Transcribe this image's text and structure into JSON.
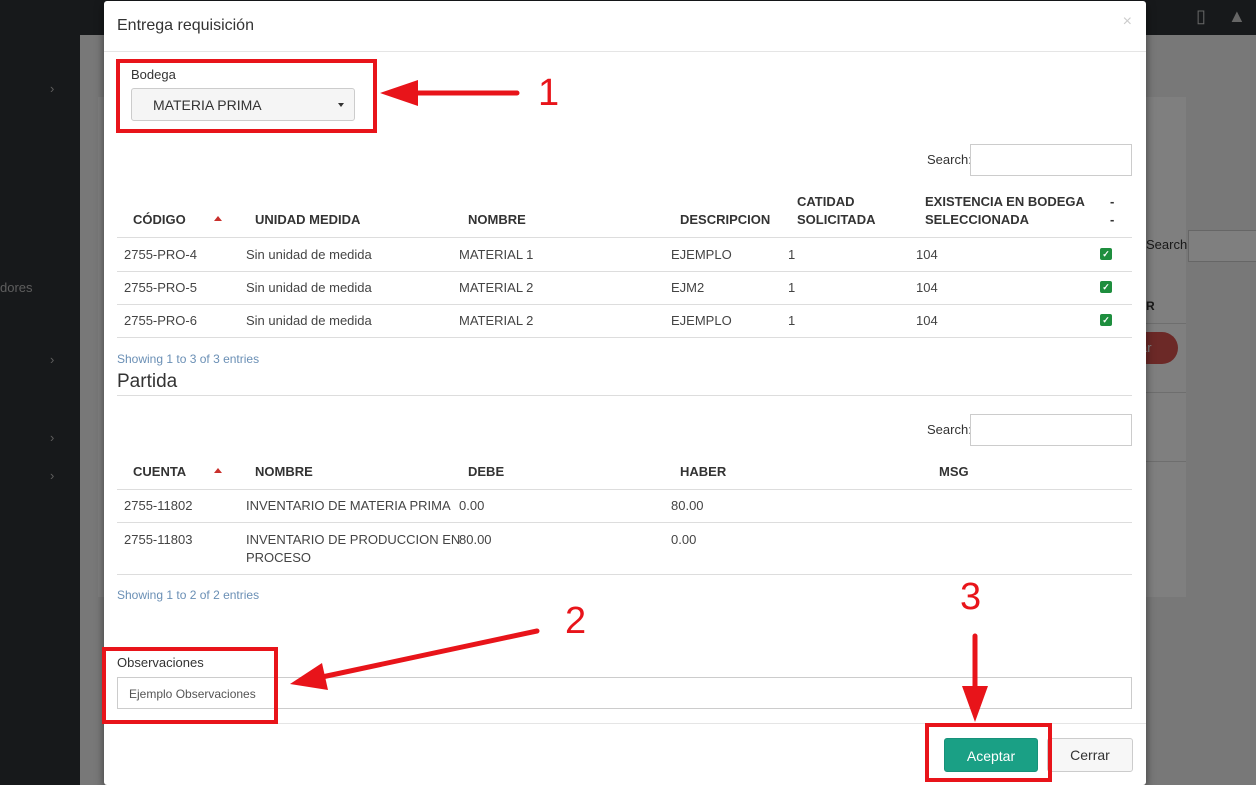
{
  "background": {
    "sidebar_text": "dores",
    "search_label": "Search:",
    "column_fragment": "R",
    "button_fragment": "ar"
  },
  "modal": {
    "title": "Entrega requisición",
    "close_icon": "×",
    "bodega": {
      "label": "Bodega",
      "selected": "MATERIA PRIMA"
    },
    "products_table": {
      "search_label": "Search:",
      "headers": [
        "CÓDIGO",
        "UNIDAD MEDIDA",
        "NOMBRE",
        "DESCRIPCION",
        "CATIDAD SOLICITADA",
        "EXISTENCIA EN BODEGA SELECCIONADA",
        "- -"
      ],
      "header_lines": {
        "qty_1": "CATIDAD",
        "qty_2": "SOLICITADA",
        "stock_1": "EXISTENCIA EN BODEGA",
        "stock_2": "SELECCIONADA",
        "last_1": "-",
        "last_2": "-"
      },
      "rows": [
        {
          "codigo": "2755-PRO-4",
          "unidad": "Sin unidad de medida",
          "nombre": "MATERIAL 1",
          "descripcion": "EJEMPLO",
          "cantidad": "1",
          "existencia": "104",
          "checked": true
        },
        {
          "codigo": "2755-PRO-5",
          "unidad": "Sin unidad de medida",
          "nombre": "MATERIAL 2",
          "descripcion": "EJM2",
          "cantidad": "1",
          "existencia": "104",
          "checked": true
        },
        {
          "codigo": "2755-PRO-6",
          "unidad": "Sin unidad de medida",
          "nombre": "MATERIAL 2",
          "descripcion": "EJEMPLO",
          "cantidad": "1",
          "existencia": "104",
          "checked": true
        }
      ],
      "info": "Showing 1 to 3 of 3 entries"
    },
    "partida": {
      "title": "Partida",
      "search_label": "Search:",
      "headers": [
        "CUENTA",
        "NOMBRE",
        "DEBE",
        "HABER",
        "MSG"
      ],
      "rows": [
        {
          "cuenta": "2755-11802",
          "nombre_1": "INVENTARIO DE MATERIA PRIMA",
          "nombre_2": "",
          "debe": "0.00",
          "haber": "80.00",
          "msg": ""
        },
        {
          "cuenta": "2755-11803",
          "nombre_1": "INVENTARIO DE PRODUCCION EN",
          "nombre_2": "PROCESO",
          "debe": "80.00",
          "haber": "0.00",
          "msg": ""
        }
      ],
      "info": "Showing 1 to 2 of 2 entries"
    },
    "observaciones": {
      "label": "Observaciones",
      "value": "Ejemplo Observaciones"
    },
    "buttons": {
      "aceptar": "Aceptar",
      "cerrar": "Cerrar"
    }
  },
  "annotations": {
    "n1": "1",
    "n2": "2",
    "n3": "3",
    "color": "#e8141a"
  },
  "colors": {
    "accent_button": "#1aa085",
    "check_green": "#1e8e3e",
    "sort_caret": "#c9302c",
    "info_text": "#6a8fb5"
  }
}
